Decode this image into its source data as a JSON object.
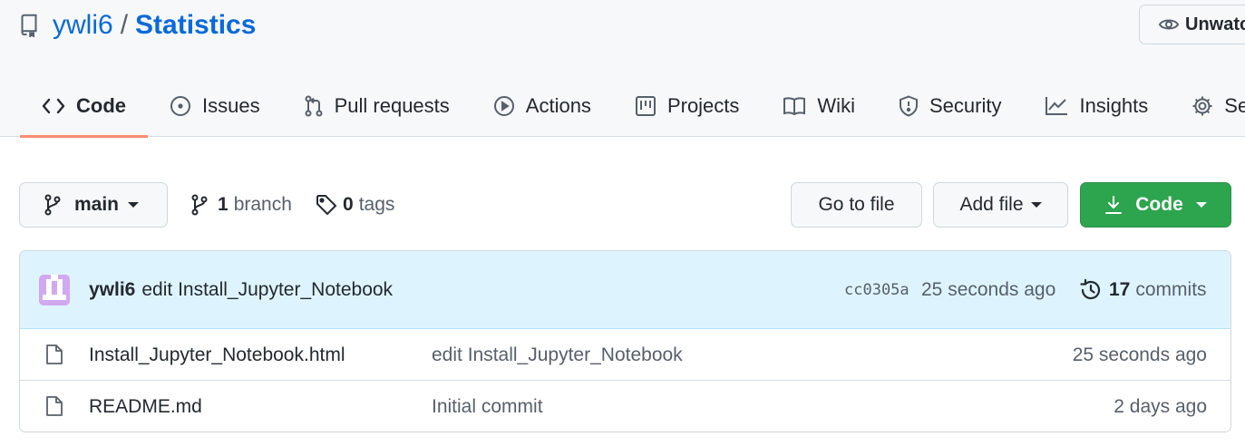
{
  "repo": {
    "owner": "ywli6",
    "separator": "/",
    "name": "Statistics"
  },
  "watch": {
    "label": "Unwatch"
  },
  "tabs": [
    {
      "label": "Code",
      "icon": "code-icon",
      "active": true
    },
    {
      "label": "Issues",
      "icon": "issue-opened-icon"
    },
    {
      "label": "Pull requests",
      "icon": "git-pull-request-icon"
    },
    {
      "label": "Actions",
      "icon": "play-icon"
    },
    {
      "label": "Projects",
      "icon": "project-icon"
    },
    {
      "label": "Wiki",
      "icon": "book-icon"
    },
    {
      "label": "Security",
      "icon": "shield-icon"
    },
    {
      "label": "Insights",
      "icon": "graph-icon"
    },
    {
      "label": "Settings",
      "icon": "gear-icon"
    }
  ],
  "toolbar": {
    "branch": "main",
    "branch_count": "1",
    "branch_word": "branch",
    "tag_count": "0",
    "tag_word": "tags",
    "go_to_file": "Go to file",
    "add_file": "Add file",
    "code": "Code"
  },
  "latest_commit": {
    "author": "ywli6",
    "message": "edit Install_Jupyter_Notebook",
    "hash": "cc0305a",
    "time": "25 seconds ago",
    "commit_count": "17",
    "commit_word": "commits"
  },
  "files": [
    {
      "name": "Install_Jupyter_Notebook.html",
      "message": "edit Install_Jupyter_Notebook",
      "time": "25 seconds ago"
    },
    {
      "name": "README.md",
      "message": "Initial commit",
      "time": "2 days ago"
    }
  ],
  "colors": {
    "accent": "#0969da",
    "primary_button": "#2da44e",
    "tab_underline": "#fd8c73",
    "commit_bar": "#ddf4ff"
  }
}
